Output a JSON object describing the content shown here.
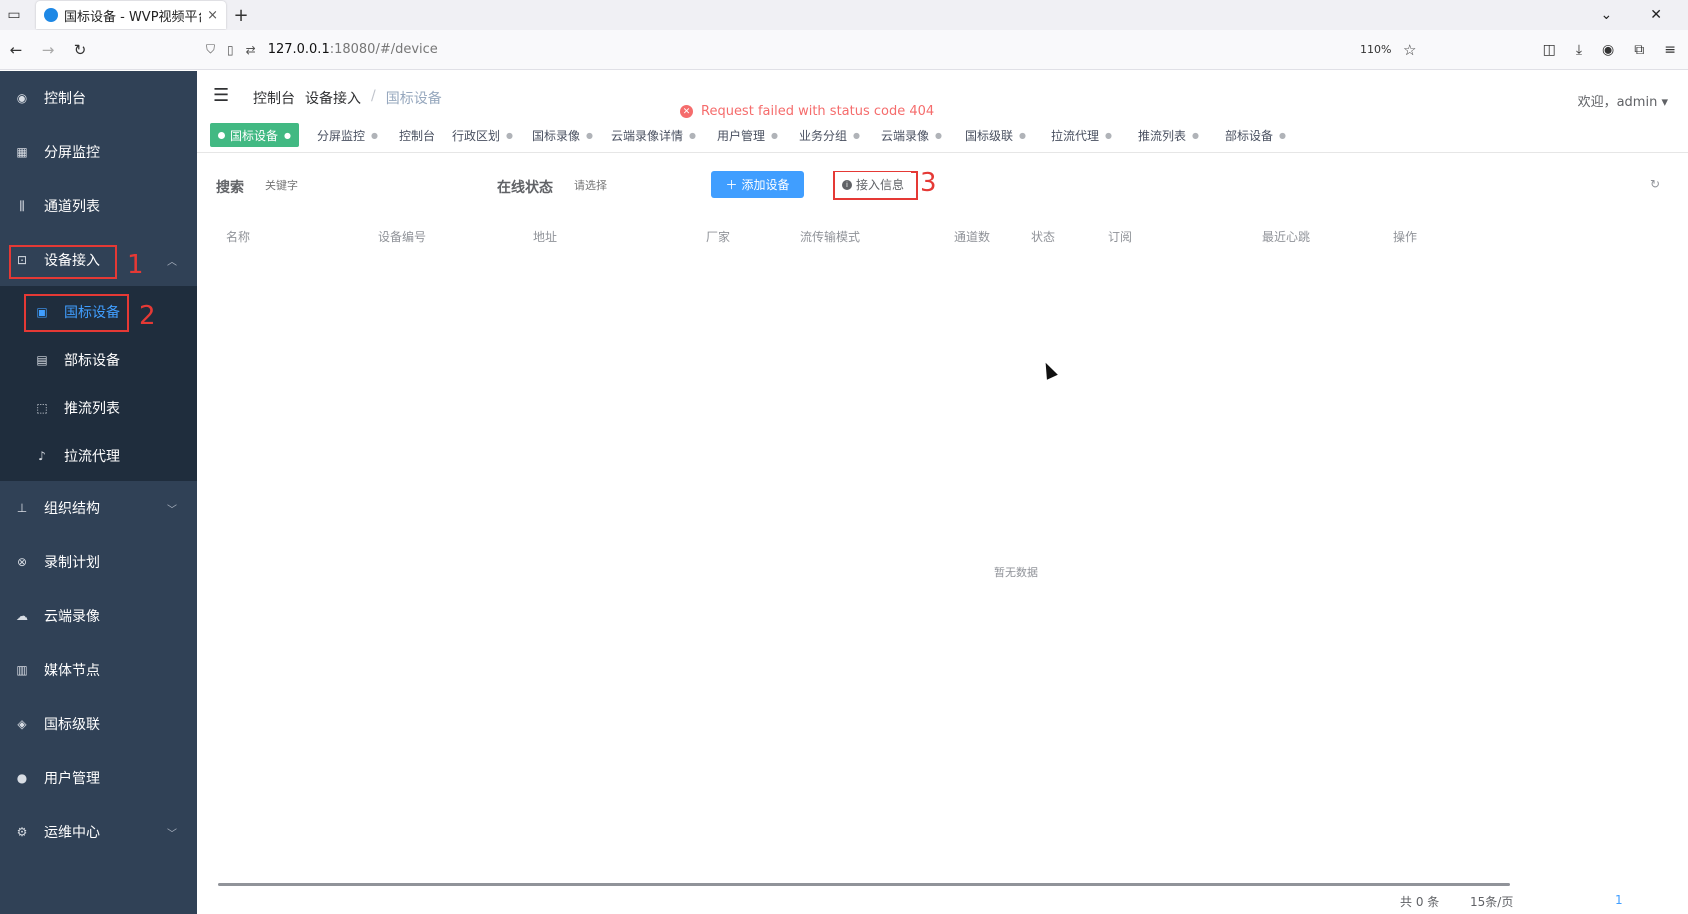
{
  "browser": {
    "tab_title": "国标设备 - WVP视频平台",
    "tab_close": "×",
    "new_tab": "+",
    "url_host": "127.0.0.1",
    "url_rest": ":18080/#/device",
    "zoom": "110%"
  },
  "sidebar": {
    "items": [
      {
        "label": "控制台",
        "icon": "dashboard-icon"
      },
      {
        "label": "分屏监控",
        "icon": "grid-icon"
      },
      {
        "label": "通道列表",
        "icon": "sliders-icon"
      },
      {
        "label": "设备接入",
        "icon": "device-icon"
      },
      {
        "label": "组织结构",
        "icon": "org-icon"
      },
      {
        "label": "录制计划",
        "icon": "record-icon"
      },
      {
        "label": "云端录像",
        "icon": "cloud-icon"
      },
      {
        "label": "媒体节点",
        "icon": "media-icon"
      },
      {
        "label": "国标级联",
        "icon": "layers-icon"
      },
      {
        "label": "用户管理",
        "icon": "user-icon"
      },
      {
        "label": "运维中心",
        "icon": "ops-icon"
      }
    ],
    "subitems": [
      {
        "label": "国标设备",
        "icon": "gb-icon"
      },
      {
        "label": "部标设备",
        "icon": "bus-icon"
      },
      {
        "label": "推流列表",
        "icon": "push-icon"
      },
      {
        "label": "拉流代理",
        "icon": "pull-icon"
      }
    ]
  },
  "annotations": [
    "1",
    "2",
    "3"
  ],
  "header": {
    "breadcrumb": [
      "控制台",
      "设备接入",
      "国标设备"
    ],
    "welcome": "欢迎，admin"
  },
  "error": {
    "message": "Request failed with status code 404"
  },
  "tags": [
    {
      "label": "国标设备",
      "active": true
    },
    {
      "label": "分屏监控"
    },
    {
      "label": "控制台"
    },
    {
      "label": "行政区划"
    },
    {
      "label": "国标录像"
    },
    {
      "label": "云端录像详情"
    },
    {
      "label": "用户管理"
    },
    {
      "label": "业务分组"
    },
    {
      "label": "云端录像"
    },
    {
      "label": "国标级联"
    },
    {
      "label": "拉流代理"
    },
    {
      "label": "推流列表"
    },
    {
      "label": "部标设备"
    }
  ],
  "toolbar": {
    "search_label": "搜索",
    "search_placeholder": "关键字",
    "status_label": "在线状态",
    "status_placeholder": "请选择",
    "add_button": "添加设备",
    "info_button": "接入信息"
  },
  "table": {
    "columns": [
      "名称",
      "设备编号",
      "地址",
      "厂家",
      "流传输模式",
      "通道数",
      "状态",
      "订阅",
      "最近心跳",
      "操作"
    ],
    "empty_text": "暂无数据"
  },
  "pagination": {
    "total": "共 0 条",
    "page_size": "15条/页",
    "current_page": "1"
  },
  "colors": {
    "sidebar_bg": "#304156",
    "submenu_bg": "#1f2d3d",
    "active_blue": "#409eff",
    "tag_green": "#42b983",
    "error_red": "#f56c6c",
    "annotation_red": "#e53935"
  }
}
